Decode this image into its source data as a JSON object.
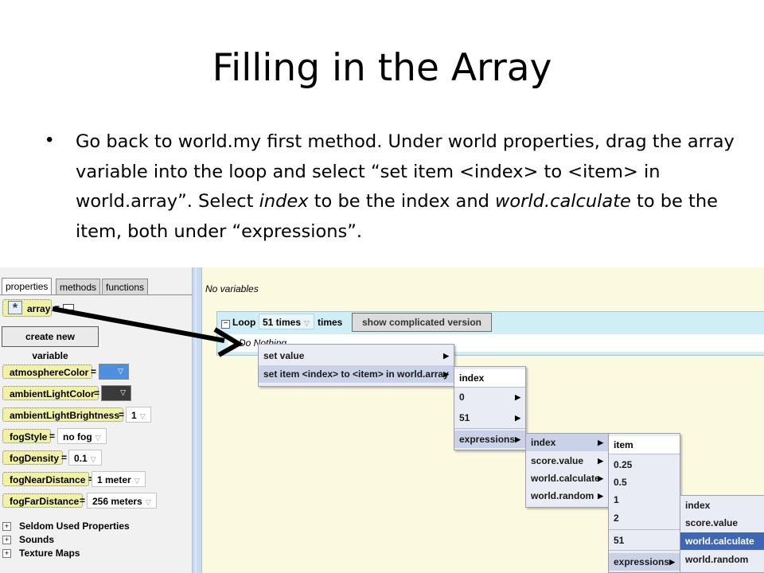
{
  "slide": {
    "title": "Filling in the Array",
    "bullet": {
      "p1": "Go back to world.my first method. Under world properties, drag the array variable into the loop and select “set item <index> to <item> in world.array”. Select ",
      "em1": "index",
      "p2": " to be the index and ",
      "em2": "world.calculate",
      "p3": " to be the item, both under “expressions”."
    }
  },
  "left_panel": {
    "tabs": [
      "properties",
      "methods",
      "functions"
    ],
    "array_var": {
      "icon_glyph": "*",
      "name": "array",
      "eq": "="
    },
    "create_button": "create new variable",
    "properties": [
      {
        "name": "atmosphereColor",
        "value": "",
        "swatch": "#4f8fe0"
      },
      {
        "name": "ambientLightColor",
        "value": "",
        "swatch": "#3a3a3a"
      },
      {
        "name": "ambientLightBrightness",
        "value": "1"
      },
      {
        "name": "fogStyle",
        "value": "no fog"
      },
      {
        "name": "fogDensity",
        "value": "0.1"
      },
      {
        "name": "fogNearDistance",
        "value": "1 meter"
      },
      {
        "name": "fogFarDistance",
        "value": "256 meters"
      }
    ],
    "tree": [
      "Seldom Used Properties",
      "Sounds",
      "Texture Maps"
    ]
  },
  "editor": {
    "no_variables": "No variables",
    "loop_label": "Loop",
    "loop_count": "51 times",
    "times_label": "times",
    "complicated_button": "show complicated version",
    "do_nothing": "Do Nothing"
  },
  "menus": {
    "m1": [
      "set value",
      "set item <index> to <item> in world.array"
    ],
    "m2": {
      "header": "index",
      "items": [
        "0",
        "51",
        "expressions"
      ]
    },
    "m3": [
      "index",
      "score.value",
      "world.calculate",
      "world.random"
    ],
    "m4": {
      "header": "item",
      "items": [
        "0.25",
        "0.5",
        "1",
        "2",
        "51",
        "expressions"
      ]
    },
    "m5": [
      "index",
      "score.value",
      "world.calculate",
      "world.random"
    ]
  },
  "colors": {
    "highlight": "#3e66b4",
    "editor_bg": "#fbfae1",
    "loop_bg": "#cfeef5"
  }
}
